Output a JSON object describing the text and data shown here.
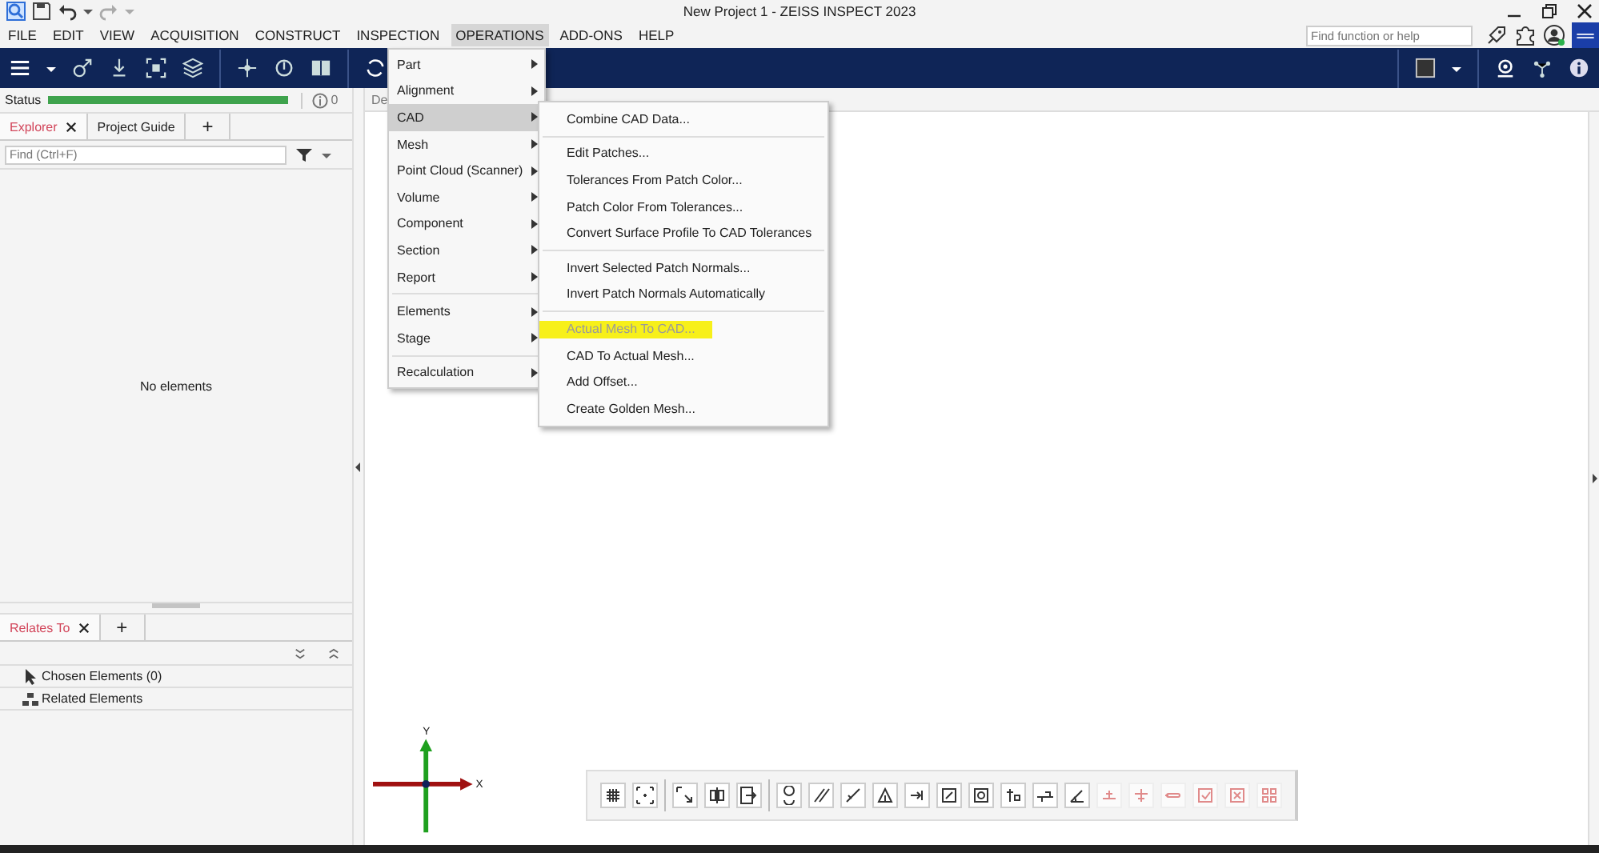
{
  "window": {
    "title": "New Project 1 - ZEISS INSPECT 2023"
  },
  "menu_bar": [
    {
      "label": "FILE",
      "selected": false
    },
    {
      "label": "EDIT",
      "selected": false
    },
    {
      "label": "VIEW",
      "selected": false
    },
    {
      "label": "ACQUISITION",
      "selected": false
    },
    {
      "label": "CONSTRUCT",
      "selected": false
    },
    {
      "label": "INSPECTION",
      "selected": false
    },
    {
      "label": "OPERATIONS",
      "selected": true
    },
    {
      "label": "ADD-ONS",
      "selected": false
    },
    {
      "label": "HELP",
      "selected": false
    }
  ],
  "help_search": {
    "placeholder": "Find function or help"
  },
  "status": {
    "label": "Status",
    "level": 1,
    "count": "0"
  },
  "explorer_tabs": [
    {
      "label": "Explorer",
      "selected": true,
      "closable": true
    },
    {
      "label": "Project Guide",
      "selected": false,
      "closable": false
    }
  ],
  "add_tab": "+",
  "find": {
    "placeholder": "Find (Ctrl+F)"
  },
  "explorer_empty": "No elements",
  "relates_tabs": [
    {
      "label": "Relates To",
      "selected": true,
      "closable": true
    }
  ],
  "relates_rows": [
    {
      "kind": "pointer",
      "label": "Chosen Elements (0)"
    },
    {
      "kind": "tree",
      "label": "Related Elements"
    }
  ],
  "view_tab": "De",
  "operations_menu": [
    [
      {
        "label": "Part",
        "selected": false
      },
      {
        "label": "Alignment",
        "selected": false
      },
      {
        "label": "CAD",
        "selected": true
      },
      {
        "label": "Mesh",
        "selected": false
      },
      {
        "label": "Point Cloud (Scanner)",
        "selected": false
      },
      {
        "label": "Volume",
        "selected": false
      },
      {
        "label": "Component",
        "selected": false
      },
      {
        "label": "Section",
        "selected": false
      },
      {
        "label": "Report",
        "selected": false
      }
    ],
    [
      {
        "label": "Elements",
        "selected": false
      },
      {
        "label": "Stage",
        "selected": false
      }
    ],
    [
      {
        "label": "Recalculation",
        "selected": false
      }
    ]
  ],
  "cad_submenu": [
    [
      {
        "label": "Combine CAD Data...",
        "disabled": false,
        "highlighted": false
      }
    ],
    [
      {
        "label": "Edit Patches...",
        "disabled": false,
        "highlighted": false
      },
      {
        "label": "Tolerances From Patch Color...",
        "disabled": false,
        "highlighted": false
      },
      {
        "label": "Patch Color From Tolerances...",
        "disabled": false,
        "highlighted": false
      },
      {
        "label": "Convert Surface Profile To CAD Tolerances",
        "disabled": false,
        "highlighted": false
      }
    ],
    [
      {
        "label": "Invert Selected Patch Normals...",
        "disabled": false,
        "highlighted": false
      },
      {
        "label": "Invert Patch Normals Automatically",
        "disabled": false,
        "highlighted": false
      }
    ],
    [
      {
        "label": "Actual Mesh To CAD...",
        "disabled": true,
        "highlighted": true
      },
      {
        "label": "CAD To Actual Mesh...",
        "disabled": false,
        "highlighted": false
      },
      {
        "label": "Add Offset...",
        "disabled": false,
        "highlighted": false
      },
      {
        "label": "Create Golden Mesh...",
        "disabled": false,
        "highlighted": false
      }
    ]
  ],
  "axes": {
    "x": "X",
    "y": "Y"
  },
  "view_toolbar": [
    [
      {
        "kind": "grid",
        "disabled": false
      },
      {
        "kind": "fit",
        "disabled": false
      }
    ],
    [
      {
        "kind": "select",
        "disabled": false
      },
      {
        "kind": "split",
        "disabled": false
      },
      {
        "kind": "view",
        "disabled": false
      }
    ],
    [
      {
        "kind": "ring",
        "disabled": false
      },
      {
        "kind": "hatch",
        "disabled": false
      },
      {
        "kind": "line",
        "disabled": false
      },
      {
        "kind": "cone",
        "disabled": false
      },
      {
        "kind": "arrow",
        "disabled": false
      },
      {
        "kind": "square",
        "disabled": false
      },
      {
        "kind": "circle",
        "disabled": false
      },
      {
        "kind": "bars",
        "disabled": false
      },
      {
        "kind": "slider",
        "disabled": false
      },
      {
        "kind": "angle",
        "disabled": false
      },
      {
        "kind": "plane",
        "disabled": true
      },
      {
        "kind": "cross",
        "disabled": true
      },
      {
        "kind": "pill",
        "disabled": true
      },
      {
        "kind": "check",
        "disabled": true
      },
      {
        "kind": "box",
        "disabled": true
      },
      {
        "kind": "dots",
        "disabled": true
      }
    ]
  ]
}
